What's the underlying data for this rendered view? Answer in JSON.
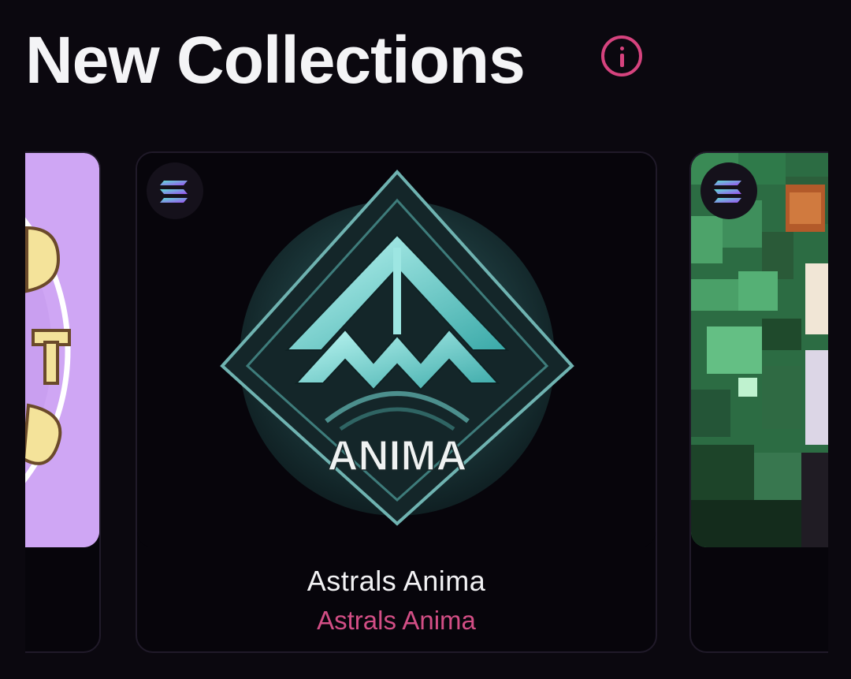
{
  "header": {
    "title": "New Collections"
  },
  "icons": {
    "info": "info-icon",
    "chain": "solana-icon"
  },
  "colors": {
    "accent": "#d6437e",
    "background": "#0b080f",
    "card_border": "#201a29"
  },
  "cards": [
    {
      "image_text": "",
      "name": "",
      "subtitle": ""
    },
    {
      "image_text": "ANIMA",
      "name": "Astrals Anima",
      "subtitle": "Astrals Anima"
    },
    {
      "image_text": "",
      "name": "",
      "subtitle": ""
    }
  ]
}
